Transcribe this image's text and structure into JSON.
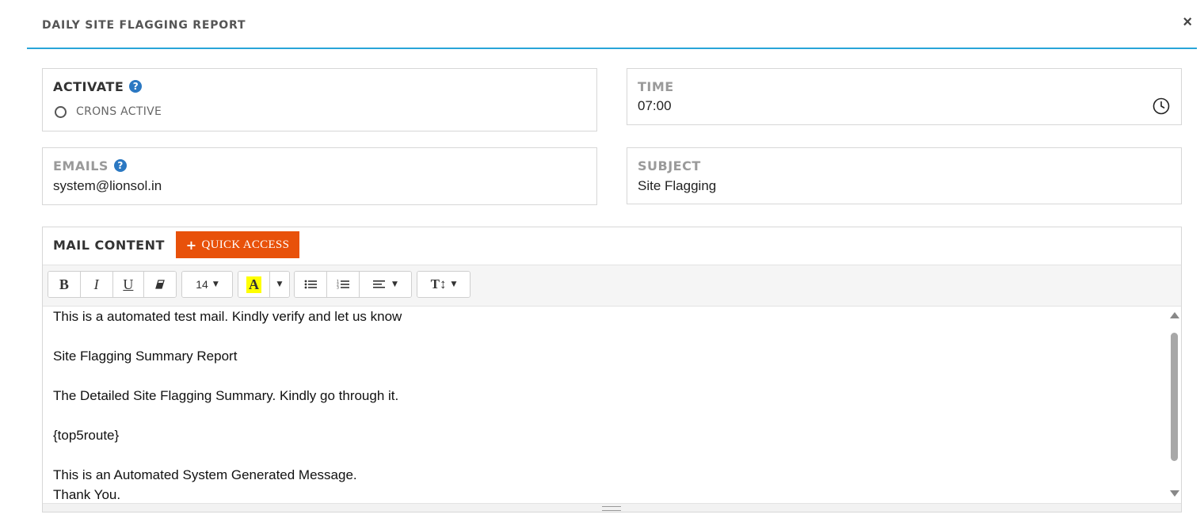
{
  "header": {
    "title": "DAILY SITE FLAGGING REPORT",
    "close_icon": "×"
  },
  "activate": {
    "label": "ACTIVATE",
    "help_icon": "?",
    "option_label": "CRONS ACTIVE"
  },
  "time": {
    "label": "TIME",
    "value": "07:00"
  },
  "emails": {
    "label": "EMAILS",
    "help_icon": "?",
    "value": "system@lionsol.in"
  },
  "subject": {
    "label": "SUBJECT",
    "value": "Site Flagging"
  },
  "mail": {
    "label": "MAIL CONTENT",
    "quick_access": "QUICK ACCESS",
    "toolbar": {
      "bold": "B",
      "italic": "I",
      "underline": "U",
      "font_size": "14",
      "highlight": "A",
      "text_size": "T↕"
    },
    "content": [
      "This is a automated test mail. Kindly verify and let us know",
      "Site Flagging Summary Report",
      "The Detailed Site Flagging Summary. Kindly go through it.",
      "{top5route}",
      "This is an Automated System Generated Message.",
      "Thank You."
    ]
  },
  "colors": {
    "accent": "#29a5d8",
    "button": "#e8510a",
    "help": "#2b78c2",
    "highlight": "#ffff00"
  }
}
